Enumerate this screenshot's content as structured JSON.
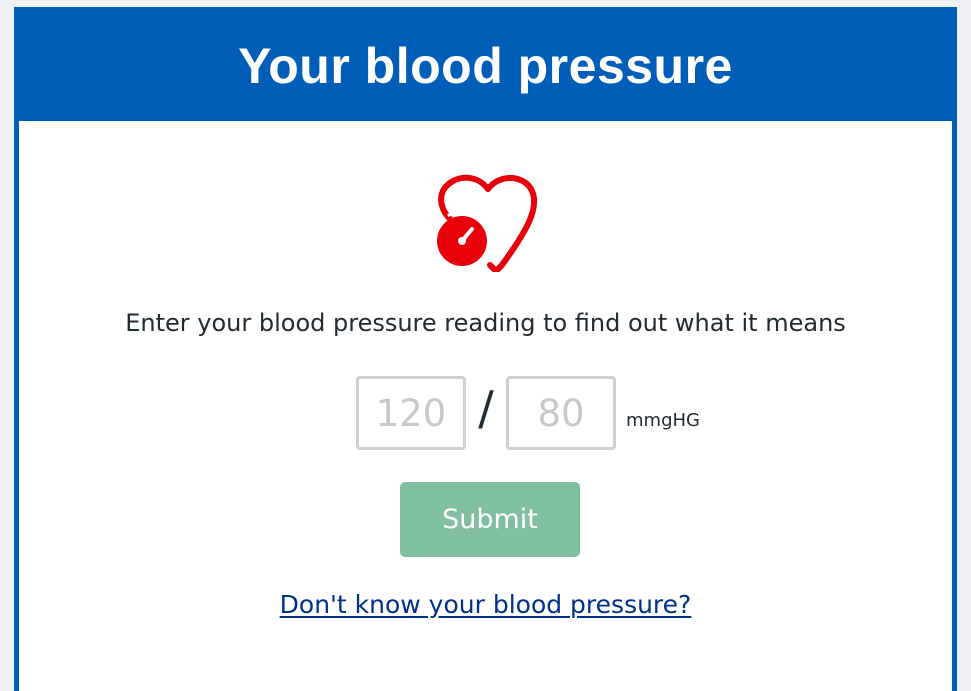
{
  "header": {
    "title": "Your blood pressure"
  },
  "logo": {
    "icon": "heart-pressure-gauge-icon",
    "color": "#e8000b"
  },
  "prompt": "Enter your blood pressure reading to find out what it means",
  "reading": {
    "systolic_placeholder": "120",
    "systolic_value": "",
    "separator": "/",
    "diastolic_placeholder": "80",
    "diastolic_value": "",
    "unit": "mmgHG"
  },
  "submit_label": "Submit",
  "help_link": "Don't know your blood pressure?",
  "colors": {
    "brand_blue": "#005eb8",
    "submit_green": "#80c0a0",
    "link_blue": "#003087"
  }
}
